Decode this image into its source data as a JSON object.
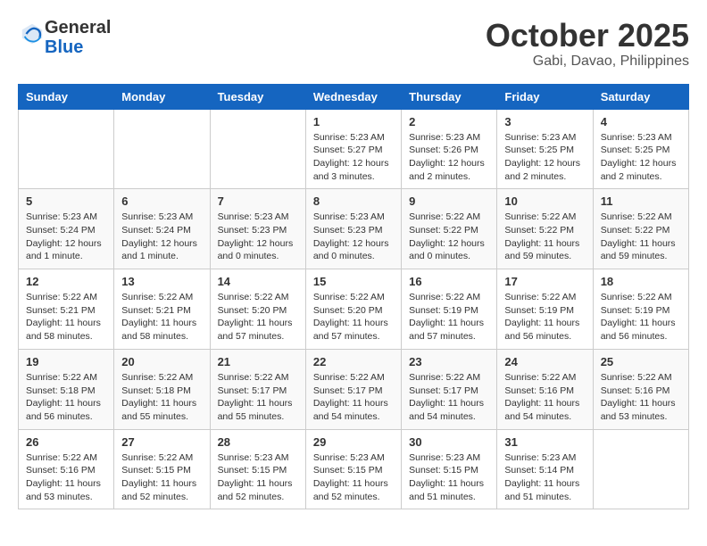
{
  "header": {
    "logo_general": "General",
    "logo_blue": "Blue",
    "month": "October 2025",
    "location": "Gabi, Davao, Philippines"
  },
  "days_of_week": [
    "Sunday",
    "Monday",
    "Tuesday",
    "Wednesday",
    "Thursday",
    "Friday",
    "Saturday"
  ],
  "weeks": [
    [
      {
        "day": "",
        "info": ""
      },
      {
        "day": "",
        "info": ""
      },
      {
        "day": "",
        "info": ""
      },
      {
        "day": "1",
        "info": "Sunrise: 5:23 AM\nSunset: 5:27 PM\nDaylight: 12 hours and 3 minutes."
      },
      {
        "day": "2",
        "info": "Sunrise: 5:23 AM\nSunset: 5:26 PM\nDaylight: 12 hours and 2 minutes."
      },
      {
        "day": "3",
        "info": "Sunrise: 5:23 AM\nSunset: 5:25 PM\nDaylight: 12 hours and 2 minutes."
      },
      {
        "day": "4",
        "info": "Sunrise: 5:23 AM\nSunset: 5:25 PM\nDaylight: 12 hours and 2 minutes."
      }
    ],
    [
      {
        "day": "5",
        "info": "Sunrise: 5:23 AM\nSunset: 5:24 PM\nDaylight: 12 hours and 1 minute."
      },
      {
        "day": "6",
        "info": "Sunrise: 5:23 AM\nSunset: 5:24 PM\nDaylight: 12 hours and 1 minute."
      },
      {
        "day": "7",
        "info": "Sunrise: 5:23 AM\nSunset: 5:23 PM\nDaylight: 12 hours and 0 minutes."
      },
      {
        "day": "8",
        "info": "Sunrise: 5:23 AM\nSunset: 5:23 PM\nDaylight: 12 hours and 0 minutes."
      },
      {
        "day": "9",
        "info": "Sunrise: 5:22 AM\nSunset: 5:22 PM\nDaylight: 12 hours and 0 minutes."
      },
      {
        "day": "10",
        "info": "Sunrise: 5:22 AM\nSunset: 5:22 PM\nDaylight: 11 hours and 59 minutes."
      },
      {
        "day": "11",
        "info": "Sunrise: 5:22 AM\nSunset: 5:22 PM\nDaylight: 11 hours and 59 minutes."
      }
    ],
    [
      {
        "day": "12",
        "info": "Sunrise: 5:22 AM\nSunset: 5:21 PM\nDaylight: 11 hours and 58 minutes."
      },
      {
        "day": "13",
        "info": "Sunrise: 5:22 AM\nSunset: 5:21 PM\nDaylight: 11 hours and 58 minutes."
      },
      {
        "day": "14",
        "info": "Sunrise: 5:22 AM\nSunset: 5:20 PM\nDaylight: 11 hours and 57 minutes."
      },
      {
        "day": "15",
        "info": "Sunrise: 5:22 AM\nSunset: 5:20 PM\nDaylight: 11 hours and 57 minutes."
      },
      {
        "day": "16",
        "info": "Sunrise: 5:22 AM\nSunset: 5:19 PM\nDaylight: 11 hours and 57 minutes."
      },
      {
        "day": "17",
        "info": "Sunrise: 5:22 AM\nSunset: 5:19 PM\nDaylight: 11 hours and 56 minutes."
      },
      {
        "day": "18",
        "info": "Sunrise: 5:22 AM\nSunset: 5:19 PM\nDaylight: 11 hours and 56 minutes."
      }
    ],
    [
      {
        "day": "19",
        "info": "Sunrise: 5:22 AM\nSunset: 5:18 PM\nDaylight: 11 hours and 56 minutes."
      },
      {
        "day": "20",
        "info": "Sunrise: 5:22 AM\nSunset: 5:18 PM\nDaylight: 11 hours and 55 minutes."
      },
      {
        "day": "21",
        "info": "Sunrise: 5:22 AM\nSunset: 5:17 PM\nDaylight: 11 hours and 55 minutes."
      },
      {
        "day": "22",
        "info": "Sunrise: 5:22 AM\nSunset: 5:17 PM\nDaylight: 11 hours and 54 minutes."
      },
      {
        "day": "23",
        "info": "Sunrise: 5:22 AM\nSunset: 5:17 PM\nDaylight: 11 hours and 54 minutes."
      },
      {
        "day": "24",
        "info": "Sunrise: 5:22 AM\nSunset: 5:16 PM\nDaylight: 11 hours and 54 minutes."
      },
      {
        "day": "25",
        "info": "Sunrise: 5:22 AM\nSunset: 5:16 PM\nDaylight: 11 hours and 53 minutes."
      }
    ],
    [
      {
        "day": "26",
        "info": "Sunrise: 5:22 AM\nSunset: 5:16 PM\nDaylight: 11 hours and 53 minutes."
      },
      {
        "day": "27",
        "info": "Sunrise: 5:22 AM\nSunset: 5:15 PM\nDaylight: 11 hours and 52 minutes."
      },
      {
        "day": "28",
        "info": "Sunrise: 5:23 AM\nSunset: 5:15 PM\nDaylight: 11 hours and 52 minutes."
      },
      {
        "day": "29",
        "info": "Sunrise: 5:23 AM\nSunset: 5:15 PM\nDaylight: 11 hours and 52 minutes."
      },
      {
        "day": "30",
        "info": "Sunrise: 5:23 AM\nSunset: 5:15 PM\nDaylight: 11 hours and 51 minutes."
      },
      {
        "day": "31",
        "info": "Sunrise: 5:23 AM\nSunset: 5:14 PM\nDaylight: 11 hours and 51 minutes."
      },
      {
        "day": "",
        "info": ""
      }
    ]
  ]
}
